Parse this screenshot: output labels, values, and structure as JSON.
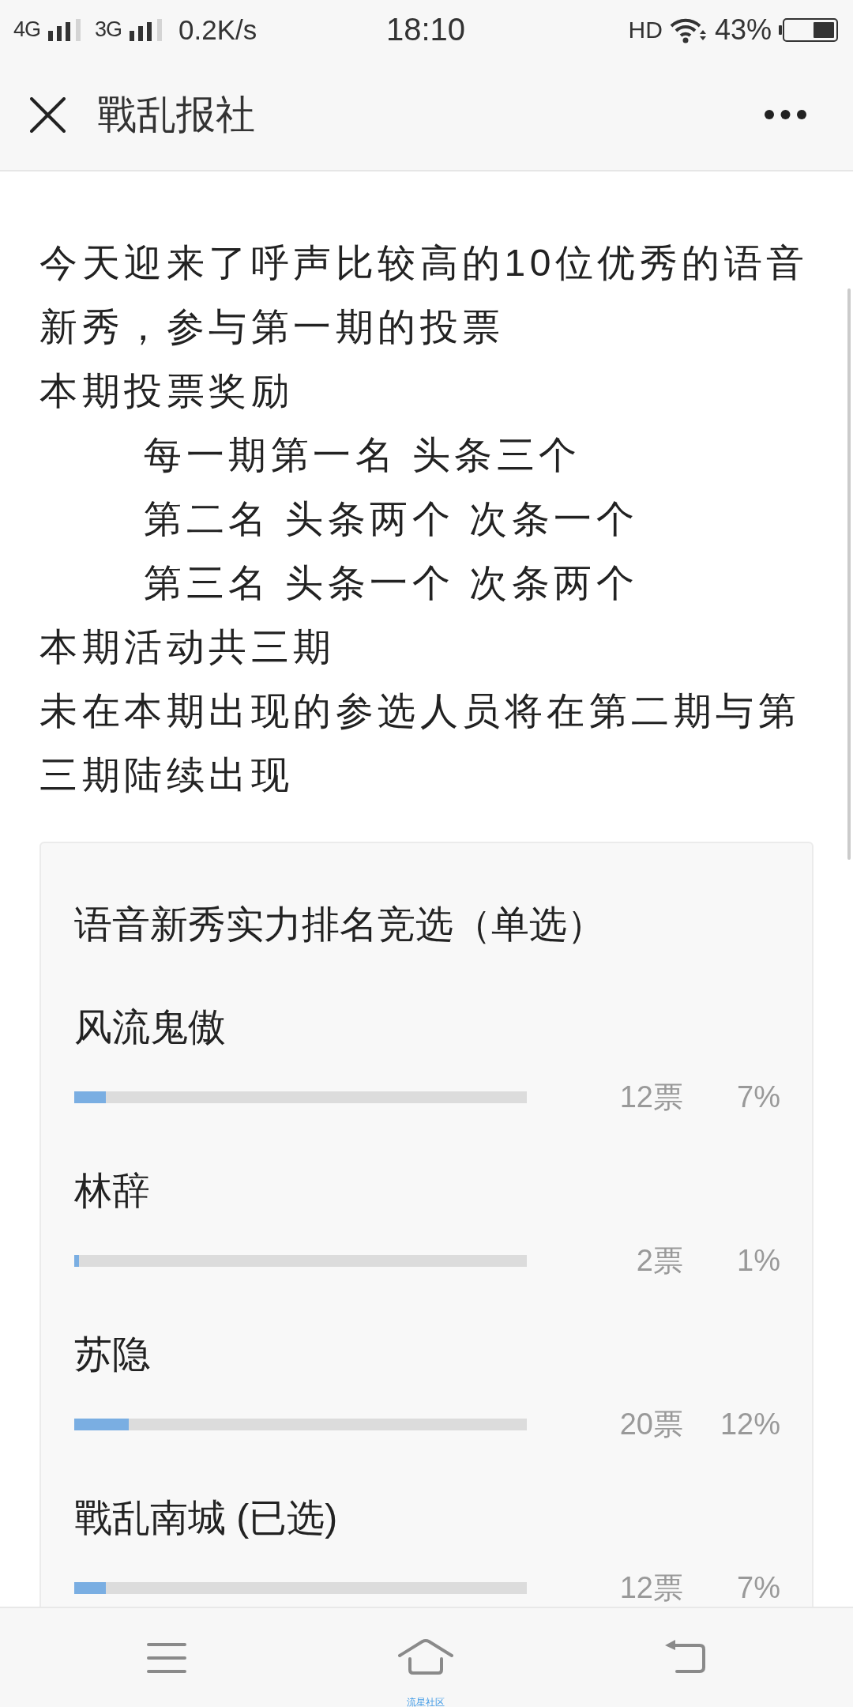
{
  "status_bar": {
    "networks": [
      {
        "label": "4G"
      },
      {
        "label": "3G"
      }
    ],
    "speed": "0.2K/s",
    "time": "18:10",
    "hd": "HD",
    "battery": "43%"
  },
  "header": {
    "title": "戰乱报社"
  },
  "article": {
    "lines": [
      {
        "text": "今天迎来了呼声比较高的10位优秀的语音新秀，参与第一期的投票",
        "indented": false
      },
      {
        "text": "本期投票奖励",
        "indented": false
      },
      {
        "text": "每一期第一名 头条三个",
        "indented": true
      },
      {
        "text": "第二名 头条两个 次条一个",
        "indented": true
      },
      {
        "text": "第三名 头条一个 次条两个",
        "indented": true
      },
      {
        "text": "本期活动共三期",
        "indented": false
      },
      {
        "text": "未在本期出现的参选人员将在第二期与第三期陆续出现",
        "indented": false
      }
    ]
  },
  "poll": {
    "title": "语音新秀实力排名竞选（单选）",
    "options": [
      {
        "name": "风流鬼傲",
        "level": 0.07,
        "votes": "12票",
        "percent": "7%"
      },
      {
        "name": "林辞",
        "level": 0.01,
        "votes": "2票",
        "percent": "1%"
      },
      {
        "name": "苏隐",
        "level": 0.12,
        "votes": "20票",
        "percent": "12%"
      },
      {
        "name": "戰乱南城 (已选)",
        "level": 0.07,
        "votes": "12票",
        "percent": "7%"
      }
    ]
  },
  "bottom_nav": {
    "items": [
      {
        "kind": "menu"
      },
      {
        "kind": "home",
        "label": "流星社区"
      },
      {
        "kind": "back"
      }
    ]
  }
}
